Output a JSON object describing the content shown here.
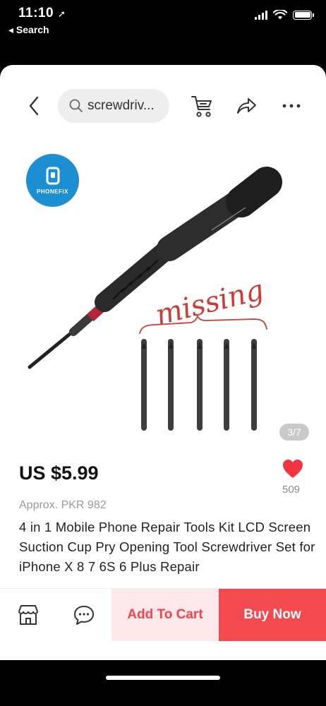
{
  "status_bar": {
    "time": "11:10",
    "back_label": "◂ Search"
  },
  "top_nav": {
    "search_query": "screwdriv..."
  },
  "gallery": {
    "brand_logo_text": "PHONEFIX",
    "image_counter": "3/7",
    "handwritten_annotation": "missing"
  },
  "product": {
    "price": "US $5.99",
    "wish_count": "509",
    "approx_price": "Approx. PKR 982",
    "title": "4 in 1 Mobile Phone Repair Tools Kit LCD Screen Suction Cup Pry Opening Tool Screwdriver Set for iPhone X 8 7 6S 6 Plus Repair"
  },
  "action_bar": {
    "add_to_cart_label": "Add To Cart",
    "buy_now_label": "Buy Now"
  },
  "colors": {
    "accent_red": "#f24a4f",
    "add_cart_bg": "#fde9e9",
    "logo_blue": "#1b8fd2"
  }
}
